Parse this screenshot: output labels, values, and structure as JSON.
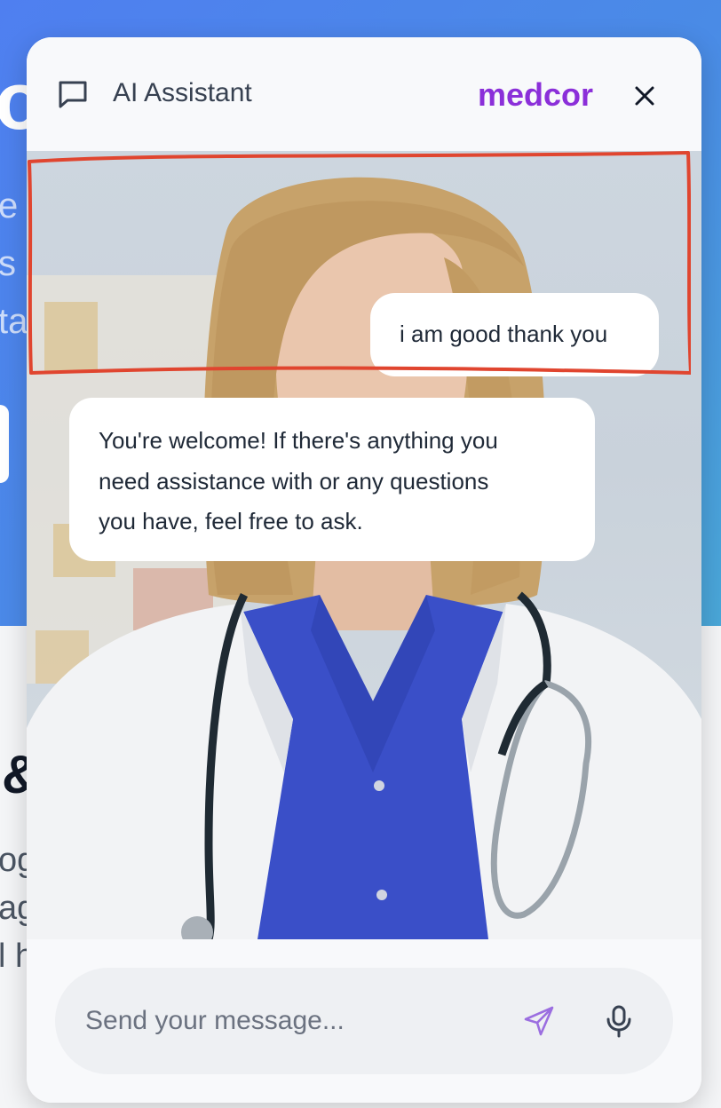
{
  "background_page": {
    "hero_title_fragment": "o",
    "hero_lines": [
      "e w",
      " s",
      "ta"
    ],
    "section_heading_fragment": "&",
    "section_text_lines": [
      "og",
      "ag",
      "l h"
    ]
  },
  "widget": {
    "title": "AI Assistant",
    "brand": "medcor",
    "brand_color": "#8b2fd9",
    "icons": {
      "header": "chat-bubble-icon",
      "close": "close-icon",
      "send": "send-icon",
      "mic": "microphone-icon"
    }
  },
  "messages": [
    {
      "role": "user",
      "text": "i am good thank you"
    },
    {
      "role": "assistant",
      "lines": [
        "You're welcome! If there's anything you",
        "need assistance with or any questions",
        "you have, feel free to ask."
      ]
    }
  ],
  "input": {
    "placeholder": "Send your message...",
    "value": ""
  },
  "annotation": {
    "color": "#e0452f",
    "shape": "hand-drawn rectangle"
  }
}
